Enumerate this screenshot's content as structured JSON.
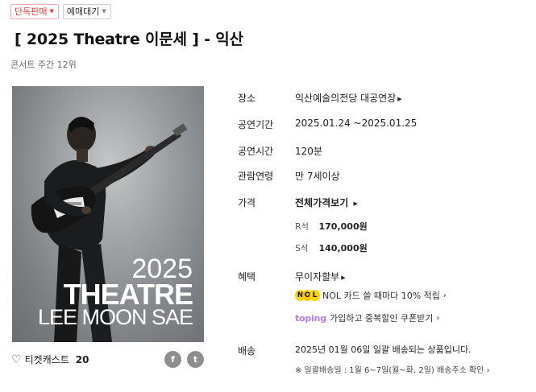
{
  "badges": {
    "exclusive": "단독판매",
    "waiting": "예매대기"
  },
  "title": "[ 2025 Theatre 이문세 ]  - 익산",
  "rank": "콘서트 주간 12위",
  "poster": {
    "year": "2025",
    "name": "THEATRE",
    "artist": "LEE MOON SAE"
  },
  "likes": {
    "label": "티켓캐스트",
    "count": "20"
  },
  "share": {
    "facebook": "f",
    "twitter": "t"
  },
  "details": {
    "venue_label": "장소",
    "venue_value": "익산예술의전당 대공연장",
    "period_label": "공연기간",
    "period_value": "2025.01.24 ~2025.01.25",
    "duration_label": "공연시간",
    "duration_value": "120분",
    "age_label": "관람연령",
    "age_value": "만 7세이상",
    "price_label": "가격",
    "price_value": "전체가격보기",
    "seats": [
      {
        "grade": "R",
        "suffix": "석",
        "price": "170,000원"
      },
      {
        "grade": "S",
        "suffix": "석",
        "price": "140,000원"
      }
    ],
    "benefit_label": "혜택",
    "benefit_value": "무이자할부",
    "nol_text": "NOL 카드 쓸 때마다 10% 적립",
    "toping_brand": "toping",
    "toping_text": "가입하고 중복할인 쿠폰받기",
    "delivery_label": "배송",
    "delivery_value": "2025년 01월 06일 일괄 배송되는 상품입니다.",
    "delivery_note": "※ 일괄배송일 : 1월 6~7일(월~화, 2일) 배송주소 확인"
  },
  "colors": {
    "accent": "#ef3e42",
    "toping": "#b57cf0",
    "nol": "#ffd400"
  }
}
